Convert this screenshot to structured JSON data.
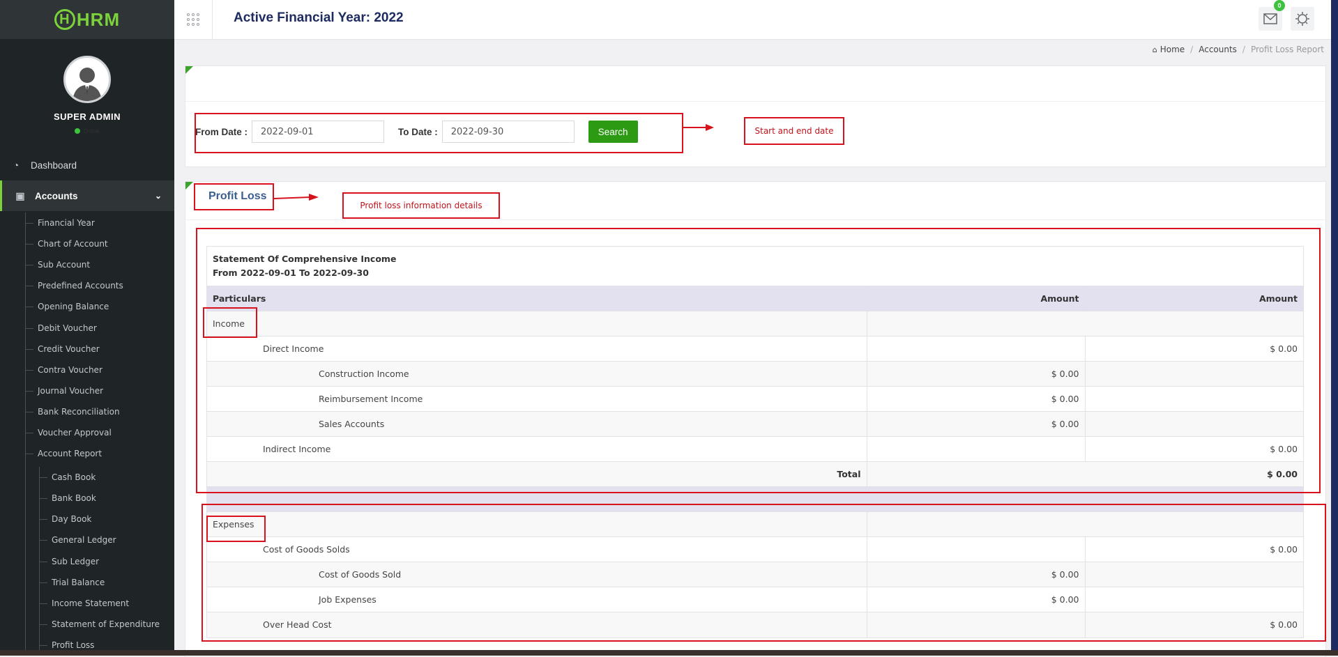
{
  "sidebar": {
    "logo_text": "HRM",
    "user_name": "SUPER ADMIN",
    "status": "Online",
    "nav": {
      "dashboard": "Dashboard",
      "accounts": "Accounts"
    },
    "accounts_items": [
      "Financial Year",
      "Chart of Account",
      "Sub Account",
      "Predefined Accounts",
      "Opening Balance",
      "Debit Voucher",
      "Credit Voucher",
      "Contra Voucher",
      "Journal Voucher",
      "Bank Reconciliation",
      "Voucher Approval",
      "Account Report"
    ],
    "report_items": [
      "Cash Book",
      "Bank Book",
      "Day Book",
      "General Ledger",
      "Sub Ledger",
      "Trial Balance",
      "Income Statement",
      "Statement of Expenditure",
      "Profit Loss"
    ]
  },
  "header": {
    "title": "Active Financial Year: 2022",
    "mail_badge": "0"
  },
  "breadcrumb": {
    "home": "Home",
    "accounts": "Accounts",
    "current": "Profit Loss Report"
  },
  "filter": {
    "from_label": "From Date :",
    "from_value": "2022-09-01",
    "to_label": "To Date :",
    "to_value": "2022-09-30",
    "search_label": "Search"
  },
  "profit_loss": {
    "title": "Profit Loss",
    "statement_title": "Statement Of Comprehensive Income",
    "statement_range": "From 2022-09-01 To 2022-09-30",
    "columns": [
      "Particulars",
      "Amount",
      "Amount"
    ],
    "income": {
      "label": "Income",
      "direct": {
        "label": "Direct Income",
        "amount": "$ 0.00"
      },
      "direct_items": [
        {
          "label": "Construction Income",
          "amount": "$ 0.00"
        },
        {
          "label": "Reimbursement Income",
          "amount": "$ 0.00"
        },
        {
          "label": "Sales Accounts",
          "amount": "$ 0.00"
        }
      ],
      "indirect": {
        "label": "Indirect Income",
        "amount": "$ 0.00"
      },
      "total_label": "Total",
      "total_amount": "$ 0.00"
    },
    "expenses": {
      "label": "Expenses",
      "cogs": {
        "label": "Cost of Goods Solds",
        "amount": "$ 0.00"
      },
      "cogs_items": [
        {
          "label": "Cost of Goods Sold",
          "amount": "$ 0.00"
        },
        {
          "label": "Job Expenses",
          "amount": "$ 0.00"
        }
      ],
      "overhead": {
        "label": "Over Head Cost",
        "amount": "$ 0.00"
      }
    }
  },
  "annotations": {
    "dates_note": "Start and end date",
    "details_note": "Profit loss information details"
  },
  "colors": {
    "sidebar_bg": "#1f2427",
    "brand_green": "#7bd23a",
    "title_navy": "#1e2b61",
    "search_button": "#2d9a14",
    "annotation_red": "#d8121d",
    "table_header": "#e3e0ef"
  }
}
